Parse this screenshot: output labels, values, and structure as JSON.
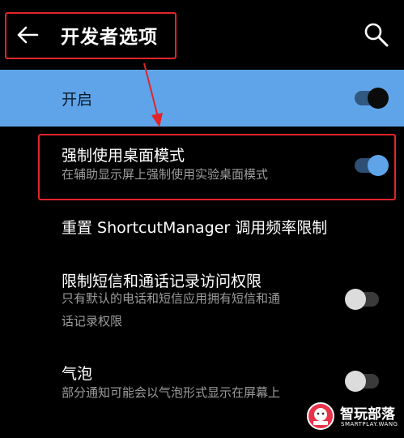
{
  "header": {
    "title": "开发者选项",
    "back_icon": "arrow-left-icon",
    "search_icon": "search-icon"
  },
  "master": {
    "label": "开启",
    "enabled": true
  },
  "settings": [
    {
      "title": "强制使用桌面模式",
      "subtitle": "在辅助显示屏上强制使用实验桌面模式",
      "enabled": true
    },
    {
      "title": "重置 ShortcutManager 调用频率限制"
    },
    {
      "title": "限制短信和通话记录访问权限",
      "subtitle_line1": "只有默认的电话和短信应用拥有短信和通",
      "subtitle_line2": "话记录权限",
      "enabled": false
    },
    {
      "title": "气泡",
      "subtitle": "部分通知可能会以气泡形式显示在屏幕上",
      "enabled": false
    }
  ],
  "watermark": {
    "name": "智玩部落",
    "url": "SMARTPLAY.WANG"
  },
  "colors": {
    "accent": "#5fa4e9",
    "annotation": "#e1242a",
    "background": "#000000"
  }
}
